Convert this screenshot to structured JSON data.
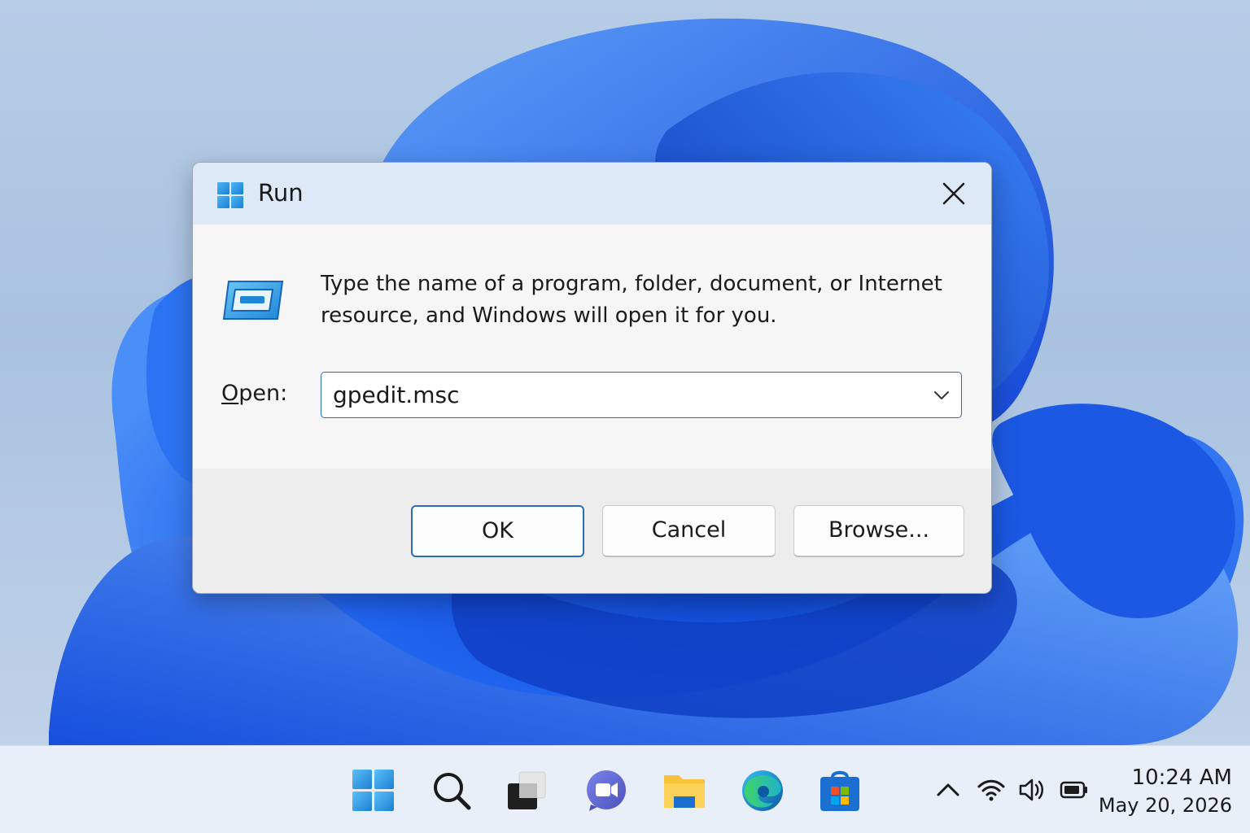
{
  "dialog": {
    "title": "Run",
    "description": "Type the name of a program, folder, document, or Internet resource, and Windows will open it for you.",
    "open_label_underlined": "O",
    "open_label_rest": "pen:",
    "input_value": "gpedit.msc",
    "buttons": {
      "ok": "OK",
      "cancel": "Cancel",
      "browse": "Browse..."
    },
    "icons": [
      "windows-logo-icon",
      "close-icon",
      "run-icon",
      "chevron-down-icon"
    ]
  },
  "taskbar": {
    "icons": [
      "start-icon",
      "search-icon",
      "task-view-icon",
      "teams-chat-icon",
      "file-explorer-icon",
      "edge-icon",
      "store-icon"
    ],
    "tray_icons": [
      "chevron-up-icon",
      "wifi-icon",
      "volume-icon",
      "battery-icon"
    ],
    "time": "10:24 AM",
    "date": "May 20, 2026"
  },
  "colors": {
    "accent": "#2b6cb5",
    "titlebar": "#dde9f6",
    "wallpaper_blue": "#1f5fe6"
  }
}
